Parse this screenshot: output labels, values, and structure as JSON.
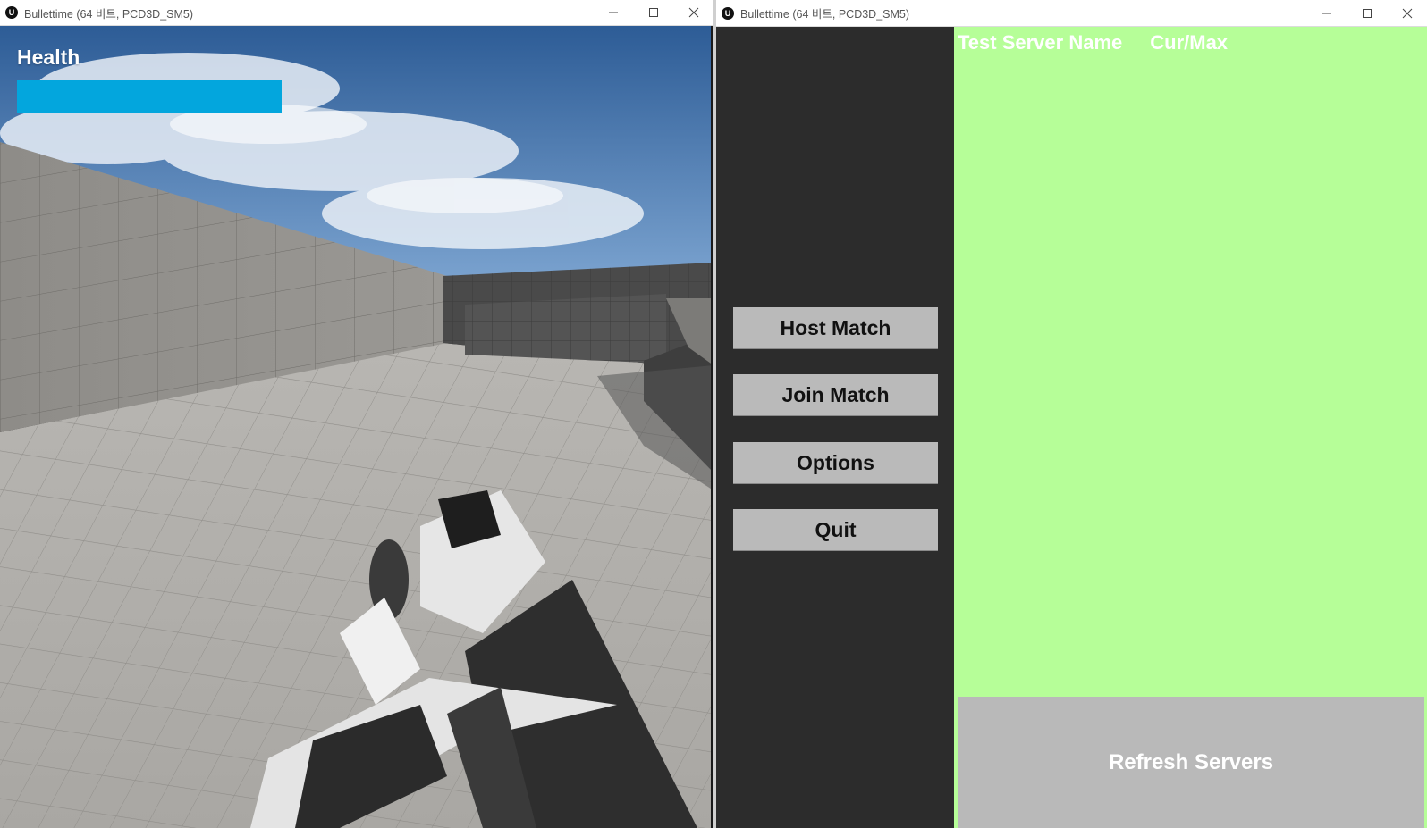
{
  "windows": {
    "left": {
      "title": "Bullettime (64 비트, PCD3D_SM5)",
      "app_icon_glyph": "U",
      "hud": {
        "health_label": "Health",
        "health_value": 1.0,
        "health_color": "#03a6dd"
      }
    },
    "right": {
      "title": "Bullettime (64 비트, PCD3D_SM5)",
      "app_icon_glyph": "U",
      "menu": {
        "host_label": "Host Match",
        "join_label": "Join Match",
        "options_label": "Options",
        "quit_label": "Quit"
      },
      "server_list": {
        "col_server_name": "Test Server Name",
        "col_players": "Cur/Max",
        "panel_color": "#b6fe98"
      },
      "refresh_label": "Refresh Servers"
    }
  },
  "window_controls": {
    "minimize_icon": "minimize-icon",
    "maximize_icon": "maximize-icon",
    "close_icon": "close-icon"
  }
}
